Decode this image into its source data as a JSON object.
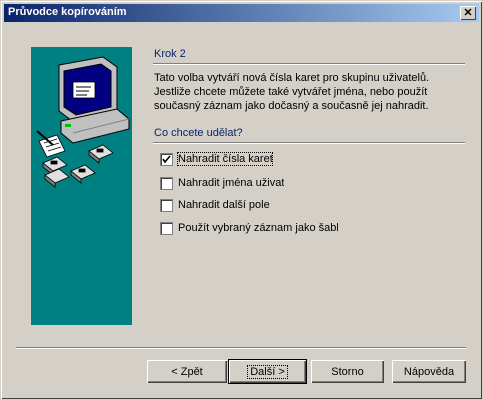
{
  "window": {
    "title": "Průvodce kopírováním",
    "close_glyph": "✕"
  },
  "step": {
    "label": "Krok 2"
  },
  "description": "Tato volba vytváří nová čísla karet pro skupinu uživatelů. Jestliže chcete můžete také vytvářet jména, nebo použít současný záznam jako dočasný a současně jej nahradit.",
  "question": "Co chcete udělat?",
  "options": [
    {
      "label": "Nahradit čísla karet",
      "checked": true
    },
    {
      "label": "Nahradit jména uživat",
      "checked": false
    },
    {
      "label": "Nahradit další pole",
      "checked": false
    },
    {
      "label": "Použít vybraný záznam jako šablo",
      "checked": false
    }
  ],
  "buttons": {
    "back": "< Zpět",
    "next": "Další >",
    "cancel": "Storno",
    "help": "Nápověda"
  },
  "colors": {
    "art_bg": "#008080",
    "titlebar": "#0a246a",
    "accent_text": "#0a246a"
  },
  "icons": {
    "art": "computer-with-disks-icon",
    "close": "close-icon",
    "check": "checkmark-icon"
  }
}
